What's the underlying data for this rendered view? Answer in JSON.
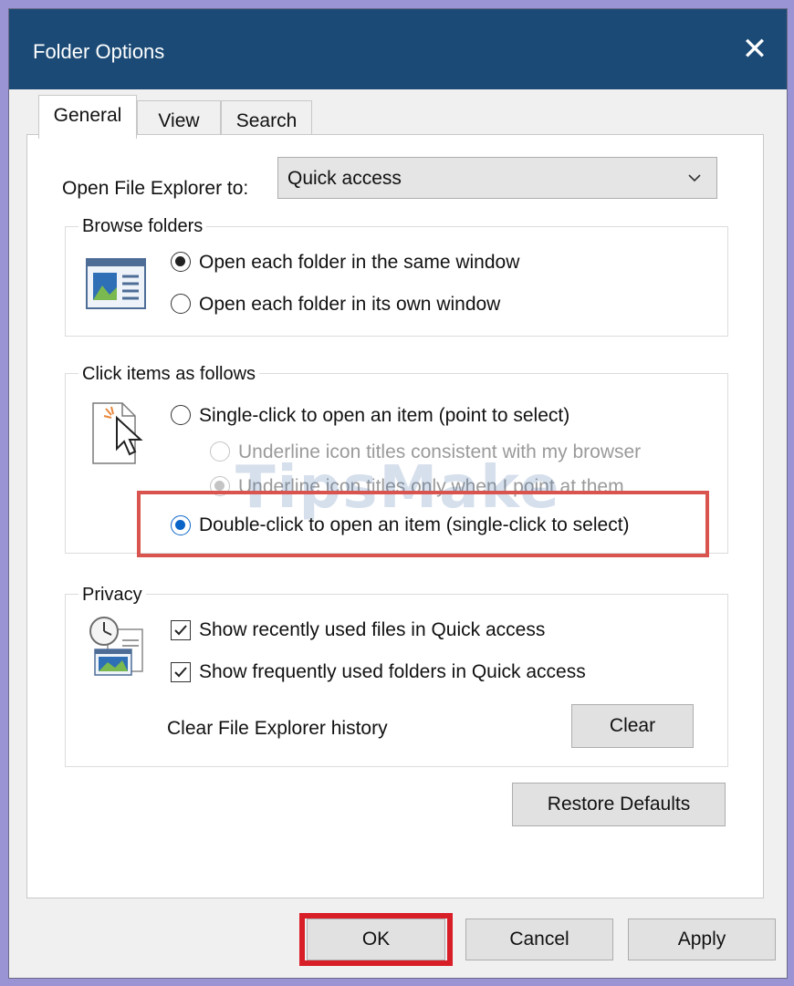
{
  "window": {
    "title": "Folder Options",
    "close_symbol": "✕"
  },
  "tabs": [
    {
      "label": "General",
      "active": true
    },
    {
      "label": "View",
      "active": false
    },
    {
      "label": "Search",
      "active": false
    }
  ],
  "open_to": {
    "label": "Open File Explorer to:",
    "selected": "Quick access"
  },
  "browse": {
    "legend": "Browse folders",
    "options": [
      {
        "label": "Open each folder in the same window",
        "checked": true
      },
      {
        "label": "Open each folder in its own window",
        "checked": false
      }
    ]
  },
  "click_items": {
    "legend": "Click items as follows",
    "single": "Single-click to open an item (point to select)",
    "sub_options": [
      {
        "label": "Underline icon titles consistent with my browser",
        "checked": false,
        "disabled": true
      },
      {
        "label": "Underline icon titles only when I point at them",
        "checked": true,
        "disabled": true
      }
    ],
    "double": "Double-click to open an item (single-click to select)",
    "double_checked": true
  },
  "privacy": {
    "legend": "Privacy",
    "recent_files": "Show recently used files in Quick access",
    "frequent_folders": "Show frequently used folders in Quick access",
    "clear_label": "Clear File Explorer history",
    "clear_button": "Clear"
  },
  "restore_defaults": "Restore Defaults",
  "footer": {
    "ok": "OK",
    "cancel": "Cancel",
    "apply": "Apply"
  },
  "watermark": "TipsMake",
  "colors": {
    "titlebar": "#1b4a76",
    "highlight": "#d9534f",
    "radio_selected": "#0a64c8"
  }
}
